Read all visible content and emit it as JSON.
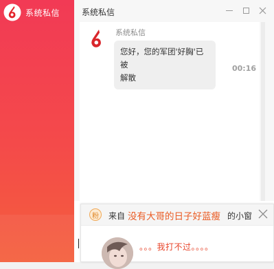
{
  "sidebar": {
    "conversation_title": "系统私信"
  },
  "window": {
    "title": "系统私信"
  },
  "message": {
    "sender": "系统私信",
    "text_line1": "您好，您的军团'好胸'已被",
    "text_line2": "解散",
    "time": "00:16"
  },
  "notification": {
    "badge": "粉",
    "from_label": "来自",
    "from_name": "没有大哥的日子好蓝瘦",
    "from_suffix": "的小窗",
    "message": "。。。我打不过。。。。"
  },
  "colors": {
    "sidebar_top": "#f23a55",
    "sidebar_bottom": "#f45f3c",
    "brand_red": "#e3242b",
    "highlight_orange": "#ea5a22"
  }
}
